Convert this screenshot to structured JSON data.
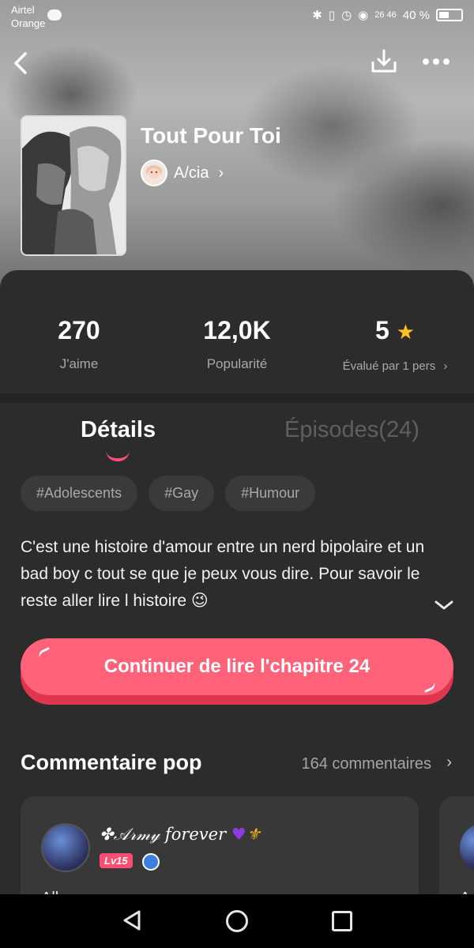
{
  "status_bar": {
    "carrier_line1": "Airtel",
    "carrier_line2": "Orange",
    "signal_labels": "26 46",
    "battery_percent": "40 %"
  },
  "header": {
    "icons": [
      "back-arrow-icon",
      "download-icon",
      "more-dots-icon"
    ]
  },
  "story": {
    "title": "Tout Pour Toi",
    "author": "A/cia"
  },
  "stats": {
    "likes_value": "270",
    "likes_label": "J'aime",
    "popularity_value": "12,0K",
    "popularity_label": "Popularité",
    "rating_value": "5",
    "rating_label": "Évalué par 1 pers"
  },
  "tabs": {
    "details": "Détails",
    "episodes": "Épisodes(24)"
  },
  "tags": [
    "#Adolescents",
    "#Gay",
    "#Humour"
  ],
  "description": "C'est une histoire d'amour entre un nerd bipolaire et un bad boy c tout se que je peux vous dire. Pour savoir le reste aller lire l histoire 😉",
  "cta": {
    "label": "Continuer de lire l'chapitre 24"
  },
  "comments": {
    "title": "Commentaire pop",
    "count_label": "164 commentaires",
    "first": {
      "username": "✤𝒜𝓇𝓂𝓎 forever",
      "level": "Lv15",
      "text_preview": "All...",
      "next_text_preview": "A"
    }
  },
  "colors": {
    "accent": "#ff6279",
    "star": "#ffc21a",
    "panel_bg": "#2c2c2c"
  }
}
